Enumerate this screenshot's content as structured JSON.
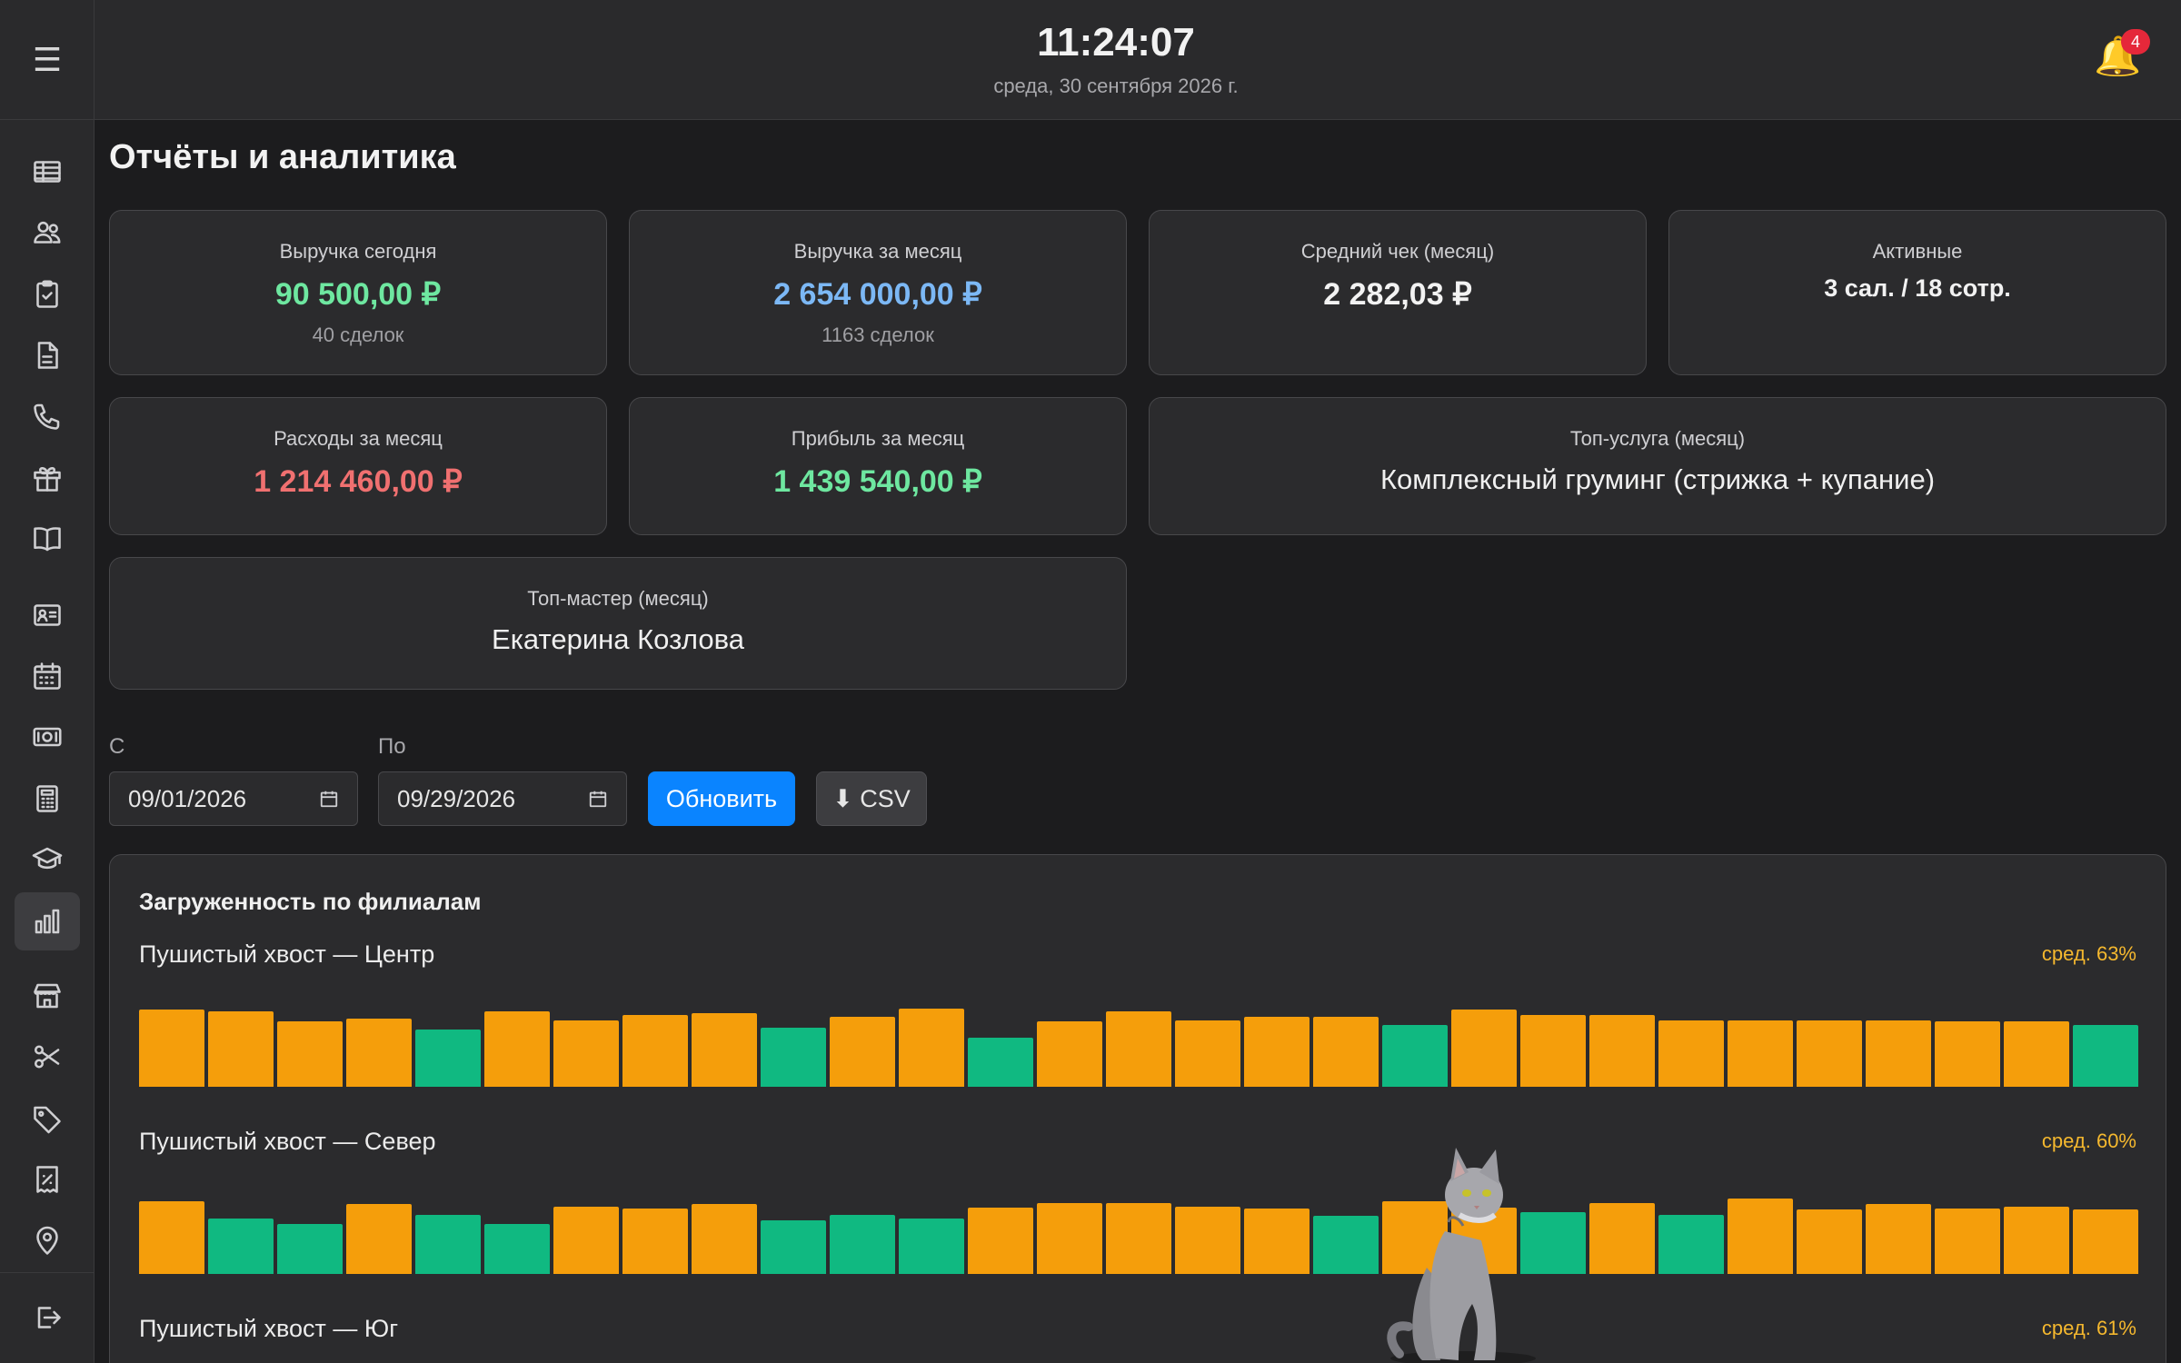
{
  "header": {
    "time": "11:24:07",
    "date": "среда, 30 сентября 2026 г.",
    "notifications_count": "4"
  },
  "page_title": "Отчёты и аналитика",
  "stats": {
    "revenue_today": {
      "label": "Выручка сегодня",
      "value": "90 500,00 ₽",
      "sub": "40 сделок"
    },
    "revenue_month": {
      "label": "Выручка за месяц",
      "value": "2 654 000,00 ₽",
      "sub": "1163 сделок"
    },
    "avg_check": {
      "label": "Средний чек (месяц)",
      "value": "2 282,03 ₽"
    },
    "active": {
      "label": "Активные",
      "value": "3 сал. / 18 сотр."
    },
    "expenses_month": {
      "label": "Расходы за месяц",
      "value": "1 214 460,00 ₽"
    },
    "profit_month": {
      "label": "Прибыль за месяц",
      "value": "1 439 540,00 ₽"
    },
    "top_service": {
      "label": "Топ-услуга (месяц)",
      "value": "Комплексный груминг (стрижка + купание)"
    },
    "top_master": {
      "label": "Топ-мастер (месяц)",
      "value": "Екатерина Козлова"
    }
  },
  "filters": {
    "from_label": "С",
    "from_value": "09/01/2026",
    "to_label": "По",
    "to_value": "09/29/2026",
    "refresh_label": "Обновить",
    "csv_label": "⬇ CSV"
  },
  "colors": {
    "high_load": "#f59e0b",
    "normal_load": "#10b981",
    "accent": "#0a84ff"
  },
  "load_panel": {
    "title": "Загруженность по филиалам",
    "branches": [
      {
        "name": "Пушистый хвост — Центр",
        "avg": "сред. 63%",
        "values": [
          72,
          70,
          61,
          64,
          53,
          70,
          62,
          67,
          69,
          55,
          65,
          73,
          46,
          61,
          70,
          62,
          65,
          65,
          58,
          72,
          67,
          67,
          62,
          62,
          62,
          62,
          61,
          61,
          58
        ],
        "high": [
          1,
          1,
          1,
          1,
          0,
          1,
          1,
          1,
          1,
          0,
          1,
          1,
          0,
          1,
          1,
          1,
          1,
          1,
          0,
          1,
          1,
          1,
          1,
          1,
          1,
          1,
          1,
          1,
          0
        ]
      },
      {
        "name": "Пушистый хвост — Север",
        "avg": "сред. 60%",
        "values": [
          68,
          52,
          47,
          65,
          55,
          47,
          63,
          61,
          65,
          50,
          55,
          52,
          62,
          66,
          66,
          63,
          61,
          54,
          68,
          62,
          58,
          66,
          55,
          70,
          60,
          65,
          61,
          63,
          60
        ],
        "high": [
          1,
          0,
          0,
          1,
          0,
          0,
          1,
          1,
          1,
          0,
          0,
          0,
          1,
          1,
          1,
          1,
          1,
          0,
          1,
          1,
          0,
          1,
          0,
          1,
          1,
          1,
          1,
          1,
          1
        ]
      },
      {
        "name": "Пушистый хвост — Юг",
        "avg": "сред. 61%",
        "values": [],
        "high": []
      }
    ]
  }
}
